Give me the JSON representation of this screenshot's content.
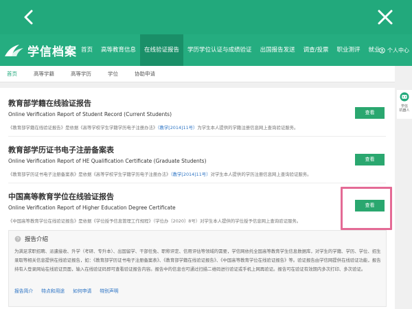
{
  "header": {
    "back_icon": "chevron-left-icon",
    "close_icon": "close-icon"
  },
  "nav": {
    "logo_text": "学信档案",
    "items": [
      "首页",
      "高等教育信息",
      "在线验证报告",
      "学历学位认证与成绩验证",
      "出国报告发送",
      "调查/投票",
      "职业测评",
      "就业"
    ],
    "active_index": 2,
    "personal": "个人中心"
  },
  "subnav": {
    "items": [
      "首页",
      "高等学籍",
      "高等学历",
      "学位",
      "协助申请"
    ],
    "active_index": 0
  },
  "sections": [
    {
      "title": "教育部学籍在线验证报告",
      "en": "Online Verification Report of Student Record (Current Students)",
      "desc_pre": "《教育部学籍在线验证报告》是依据《高等学校学生学籍学历电子注册办法》",
      "desc_link": "（教学[2014]11号）",
      "desc_post": "为学生本人提供的学籍注册信息网上查询验证服务。",
      "button": "查看"
    },
    {
      "title": "教育部学历证书电子注册备案表",
      "en": "Online Verification Report of HE Qualification Certificate (Graduate Students)",
      "desc_pre": "《教育部学历证书电子注册备案表》是依据《高等学校学生学籍学历电子注册办法》",
      "desc_link": "（教学[2014]11号）",
      "desc_post": "对学生本人提供的学历注册信息网上查询验证服务。",
      "button": "查看"
    },
    {
      "title": "中国高等教育学位在线验证报告",
      "en": "Online Verification Report of Higher Education Degree Certificate",
      "desc_pre": "《中国高等教育学位在线验证报告》是依据《学位授予信息管理工作规程》（学位办〔2020〕8号）对学生本人提供的学位授予信息网上查询验证服务。",
      "desc_link": "",
      "desc_post": "",
      "button": "查看"
    }
  ],
  "intro": {
    "title": "报告介绍",
    "body": "为满足求职招聘、派遣接收、升学（考研、专升本）、出国留学、干部任免、职称评定、信用评估等领域的需要，学信网依托全国高等教育学生信息数据库，对学生的学籍、学历、学位、招生录取等相关信息提供在线验证报告，如：《教育部学历证书电子注册备案表》、《教育部学籍在线验证报告》、《中国高等教育学位在线验证报告》等。验证报告由学信网提供在线验证功能，报告持有人登录网站在线验证页面，输入在线验证码即可查看验证报告内容。报告中的信息也可通过扫描二维码进行验证或手机上网再验证。报告可在验证有效期内多次打印、多次验证。",
    "links": [
      "报告简介",
      "特点和用途",
      "如何申请",
      "特别声明"
    ]
  },
  "robot": {
    "label_1": "学信",
    "label_2": "机器人"
  },
  "colors": {
    "header": "#22a97c",
    "nav": "#25ad80",
    "button": "#2aa76f",
    "highlight": "#e46a95",
    "link": "#2b73c4"
  }
}
